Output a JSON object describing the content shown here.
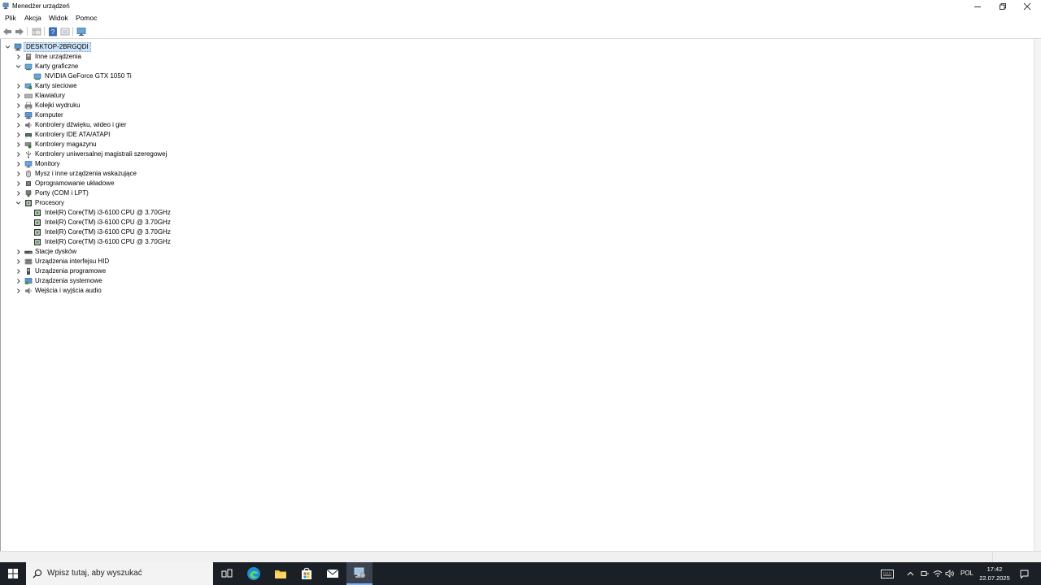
{
  "window": {
    "title": "Menedżer urządzeń"
  },
  "menu": [
    "Plik",
    "Akcja",
    "Widok",
    "Pomoc"
  ],
  "tree": {
    "root": "DESKTOP-2BRGQDI",
    "categories": [
      {
        "label": "Inne urządzenia",
        "icon": "unknown-device-icon",
        "expanded": false,
        "children": []
      },
      {
        "label": "Karty graficzne",
        "icon": "display-adapter-icon",
        "expanded": true,
        "children": [
          "NVIDIA GeForce GTX 1050 Ti"
        ]
      },
      {
        "label": "Karty sieciowe",
        "icon": "network-adapter-icon",
        "expanded": false,
        "children": []
      },
      {
        "label": "Klawiatury",
        "icon": "keyboard-icon",
        "expanded": false,
        "children": []
      },
      {
        "label": "Kolejki wydruku",
        "icon": "printer-icon",
        "expanded": false,
        "children": []
      },
      {
        "label": "Komputer",
        "icon": "computer-icon",
        "expanded": false,
        "children": []
      },
      {
        "label": "Kontrolery dźwięku, wideo i gier",
        "icon": "speaker-icon",
        "expanded": false,
        "children": []
      },
      {
        "label": "Kontrolery IDE ATA/ATAPI",
        "icon": "ide-controller-icon",
        "expanded": false,
        "children": []
      },
      {
        "label": "Kontrolery magazynu",
        "icon": "storage-controller-icon",
        "expanded": false,
        "children": []
      },
      {
        "label": "Kontrolery uniwersalnej magistrali szeregowej",
        "icon": "usb-icon",
        "expanded": false,
        "children": []
      },
      {
        "label": "Monitory",
        "icon": "monitor-icon",
        "expanded": false,
        "children": []
      },
      {
        "label": "Mysz i inne urządzenia wskazujące",
        "icon": "mouse-icon",
        "expanded": false,
        "children": []
      },
      {
        "label": "Oprogramowanie układowe",
        "icon": "firmware-icon",
        "expanded": false,
        "children": []
      },
      {
        "label": "Porty (COM i LPT)",
        "icon": "port-icon",
        "expanded": false,
        "children": []
      },
      {
        "label": "Procesory",
        "icon": "processor-icon",
        "expanded": true,
        "children": [
          "Intel(R) Core(TM) i3-6100 CPU @ 3.70GHz",
          "Intel(R) Core(TM) i3-6100 CPU @ 3.70GHz",
          "Intel(R) Core(TM) i3-6100 CPU @ 3.70GHz",
          "Intel(R) Core(TM) i3-6100 CPU @ 3.70GHz"
        ]
      },
      {
        "label": "Stacje dysków",
        "icon": "disk-drive-icon",
        "expanded": false,
        "children": []
      },
      {
        "label": "Urządzenia interfejsu HID",
        "icon": "hid-icon",
        "expanded": false,
        "children": []
      },
      {
        "label": "Urządzenia programowe",
        "icon": "software-device-icon",
        "expanded": false,
        "children": []
      },
      {
        "label": "Urządzenia systemowe",
        "icon": "system-device-icon",
        "expanded": false,
        "children": []
      },
      {
        "label": "Wejścia i wyjścia audio",
        "icon": "audio-io-icon",
        "expanded": false,
        "children": []
      }
    ]
  },
  "taskbar": {
    "search_placeholder": "Wpisz tutaj, aby wyszukać",
    "language": "POL",
    "time": "17:42",
    "date": "22.07.2025"
  }
}
